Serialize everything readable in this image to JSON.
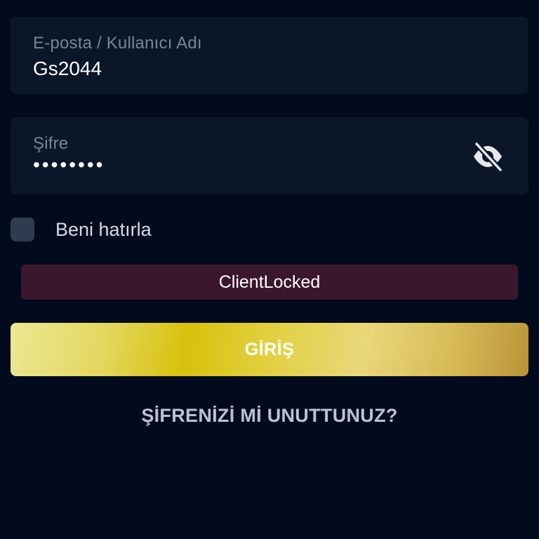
{
  "login_form": {
    "username": {
      "label": "E-posta / Kullanıcı Adı",
      "value": "Gs2044"
    },
    "password": {
      "label": "Şifre",
      "masked_value": "••••••••",
      "visibility_icon": "eye-off-icon"
    },
    "remember_me": {
      "label": "Beni hatırla",
      "checked": false
    },
    "error_message": "ClientLocked",
    "login_button_label": "GİRİŞ",
    "forgot_password_link": "ŞİFRENİZİ Mİ UNUTTUNUZ?"
  },
  "colors": {
    "background": "#020b1e",
    "field_background": "#0c1629",
    "error_background": "#3b172e",
    "button_gold": "#d8c10c",
    "checkbox": "#2f3b4f"
  }
}
